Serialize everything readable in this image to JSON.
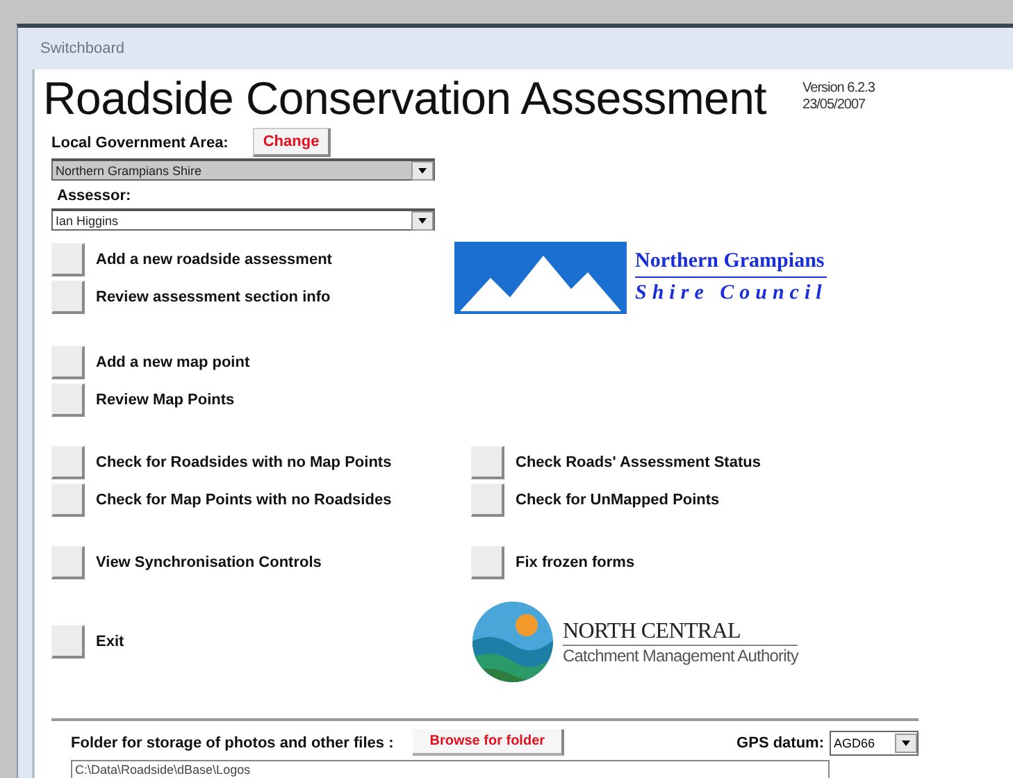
{
  "window": {
    "title": "Switchboard"
  },
  "header": {
    "title": "Roadside Conservation Assessment",
    "version": "Version 6.2.3",
    "date": "23/05/2007"
  },
  "lga": {
    "label": "Local Government Area:",
    "change_button": "Change",
    "value": "Northern Grampians Shire"
  },
  "assessor": {
    "label": "Assessor:",
    "value": "Ian Higgins"
  },
  "council_logo": {
    "line_1": "Northern Grampians",
    "line_2": "Shire Council"
  },
  "sections": [
    {
      "rows": [
        [
          {
            "label": "Add a new roadside assessment"
          }
        ],
        [
          {
            "label": "Review assessment section info"
          }
        ]
      ]
    },
    {
      "rows": [
        [
          {
            "label": "Add a new map point"
          }
        ],
        [
          {
            "label": "Review Map Points"
          }
        ]
      ]
    },
    {
      "rows": [
        [
          {
            "label": "Check for Roadsides with no Map Points"
          },
          {
            "label": "Check Roads' Assessment Status"
          }
        ],
        [
          {
            "label": "Check for Map Points with no Roadsides"
          },
          {
            "label": "Check for UnMapped Points"
          }
        ]
      ]
    },
    {
      "rows": [
        [
          {
            "label": "View Synchronisation Controls"
          },
          {
            "label": "Fix frozen forms"
          }
        ]
      ]
    }
  ],
  "exit_button": {
    "label": "Exit"
  },
  "cma_logo": {
    "line_1": "NORTH CENTRAL",
    "line_2": "Catchment Management Authority"
  },
  "footer": {
    "folder_label": "Folder for storage of photos and other files :",
    "browse_button": "Browse for folder",
    "gps_label": "GPS datum:",
    "gps_value": "AGD66",
    "folder_path": "C:\\Data\\Roadside\\dBase\\Logos"
  }
}
